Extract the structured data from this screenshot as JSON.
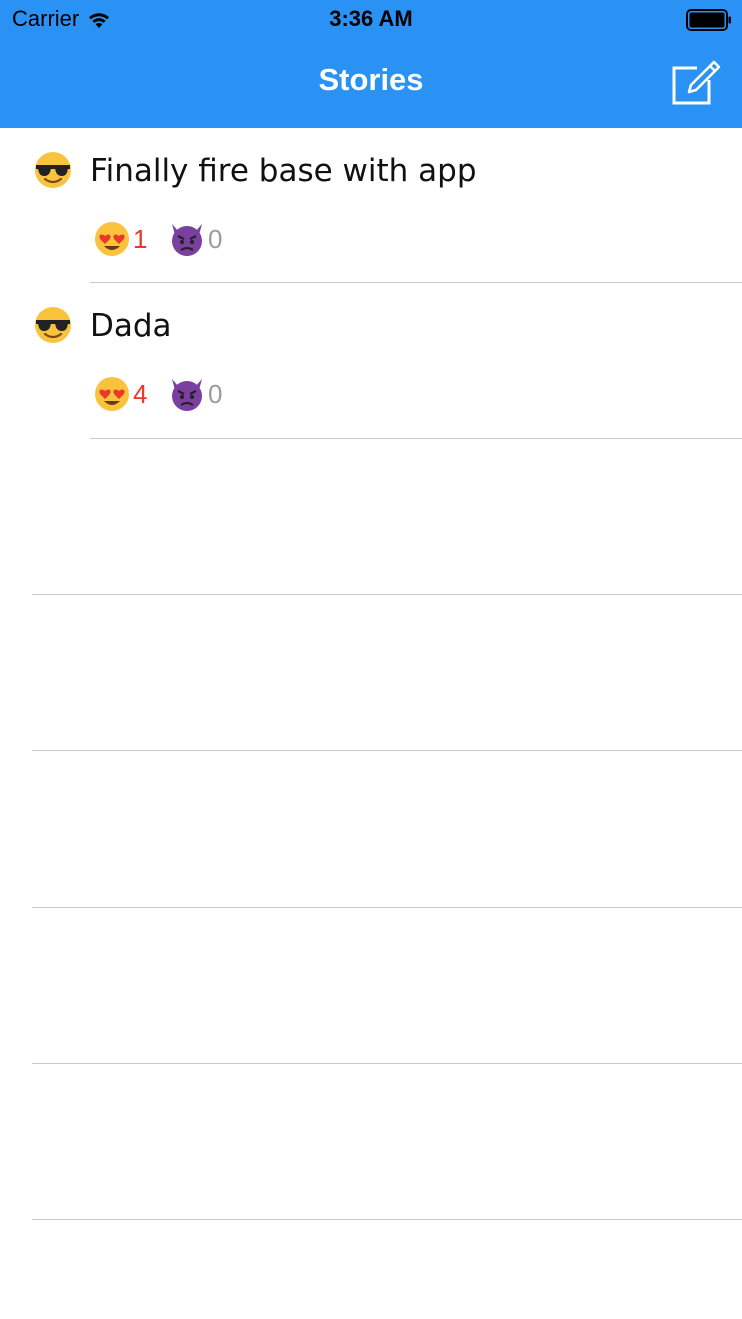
{
  "status_bar": {
    "carrier": "Carrier",
    "time": "3:36 AM"
  },
  "nav": {
    "title": "Stories",
    "compose_icon": "compose-icon"
  },
  "colors": {
    "nav_bar": "#2B92F5",
    "like_count": "#E8392B",
    "hate_count": "#9B9B9B",
    "separator": "#c8c7cc"
  },
  "stories": [
    {
      "avatar": "sunglasses-emoji",
      "title": "Finally fire base with app",
      "likes": "1",
      "hates": "0"
    },
    {
      "avatar": "sunglasses-emoji",
      "title": "Dada",
      "likes": "4",
      "hates": "0"
    }
  ]
}
